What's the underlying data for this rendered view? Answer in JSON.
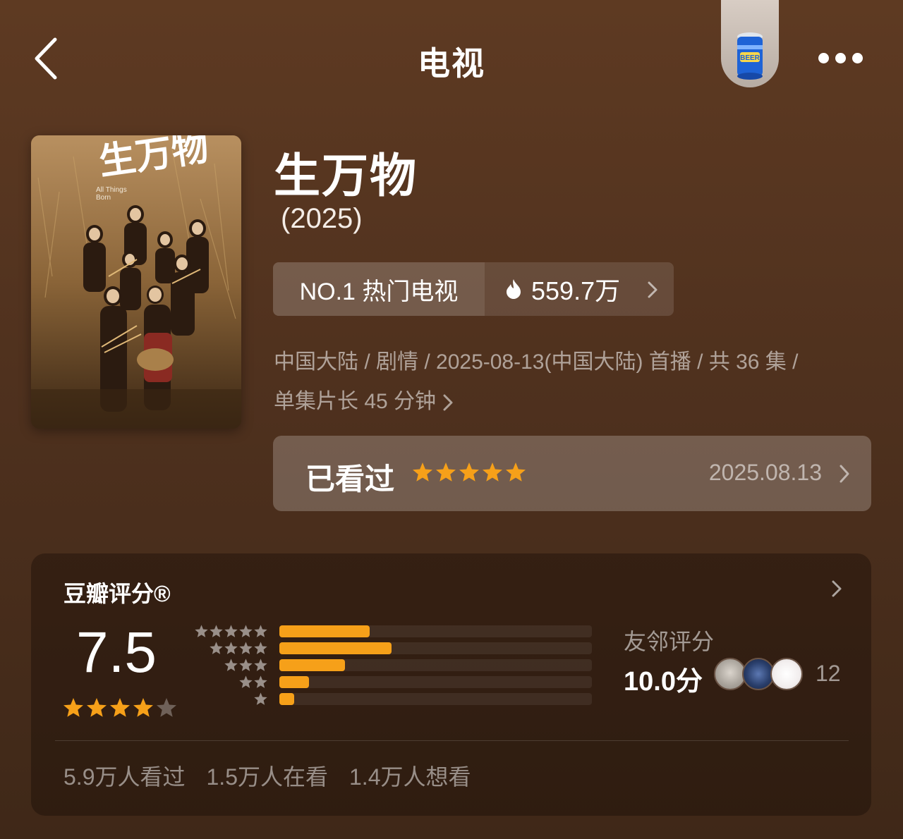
{
  "header": {
    "title": "电视",
    "back_icon": "chevron-left-icon",
    "more_icon": "more-dots-icon",
    "beer_icon": "beer-can-icon"
  },
  "show": {
    "name": "生万物",
    "year": "(2025)",
    "poster": {
      "title_text": "生万物",
      "english_title": "All Things Born"
    },
    "rank": {
      "label": "NO.1 热门电视",
      "heat": "559.7万"
    },
    "meta_line1": "中国大陆 / 剧情 / 2025-08-13(中国大陆) 首播 / 共 36 集 /",
    "meta_line2": "单集片长 45 分钟"
  },
  "watched": {
    "label": "已看过",
    "stars": 5,
    "date": "2025.08.13"
  },
  "rating": {
    "title": "豆瓣评分®",
    "score": "7.5",
    "score_stars": 4,
    "distribution": [
      {
        "stars": 5,
        "fraction": 0.29
      },
      {
        "stars": 4,
        "fraction": 0.36
      },
      {
        "stars": 3,
        "fraction": 0.21
      },
      {
        "stars": 2,
        "fraction": 0.095
      },
      {
        "stars": 1,
        "fraction": 0.048
      }
    ],
    "friends_label": "友邻评分",
    "friends_score": "10.0分",
    "friends_count": "12",
    "stats": {
      "watched": "5.9万人看过",
      "watching": "1.5万人在看",
      "want": "1.4万人想看"
    }
  },
  "colors": {
    "accent_star": "#f6a019",
    "background": "#5a3820"
  }
}
